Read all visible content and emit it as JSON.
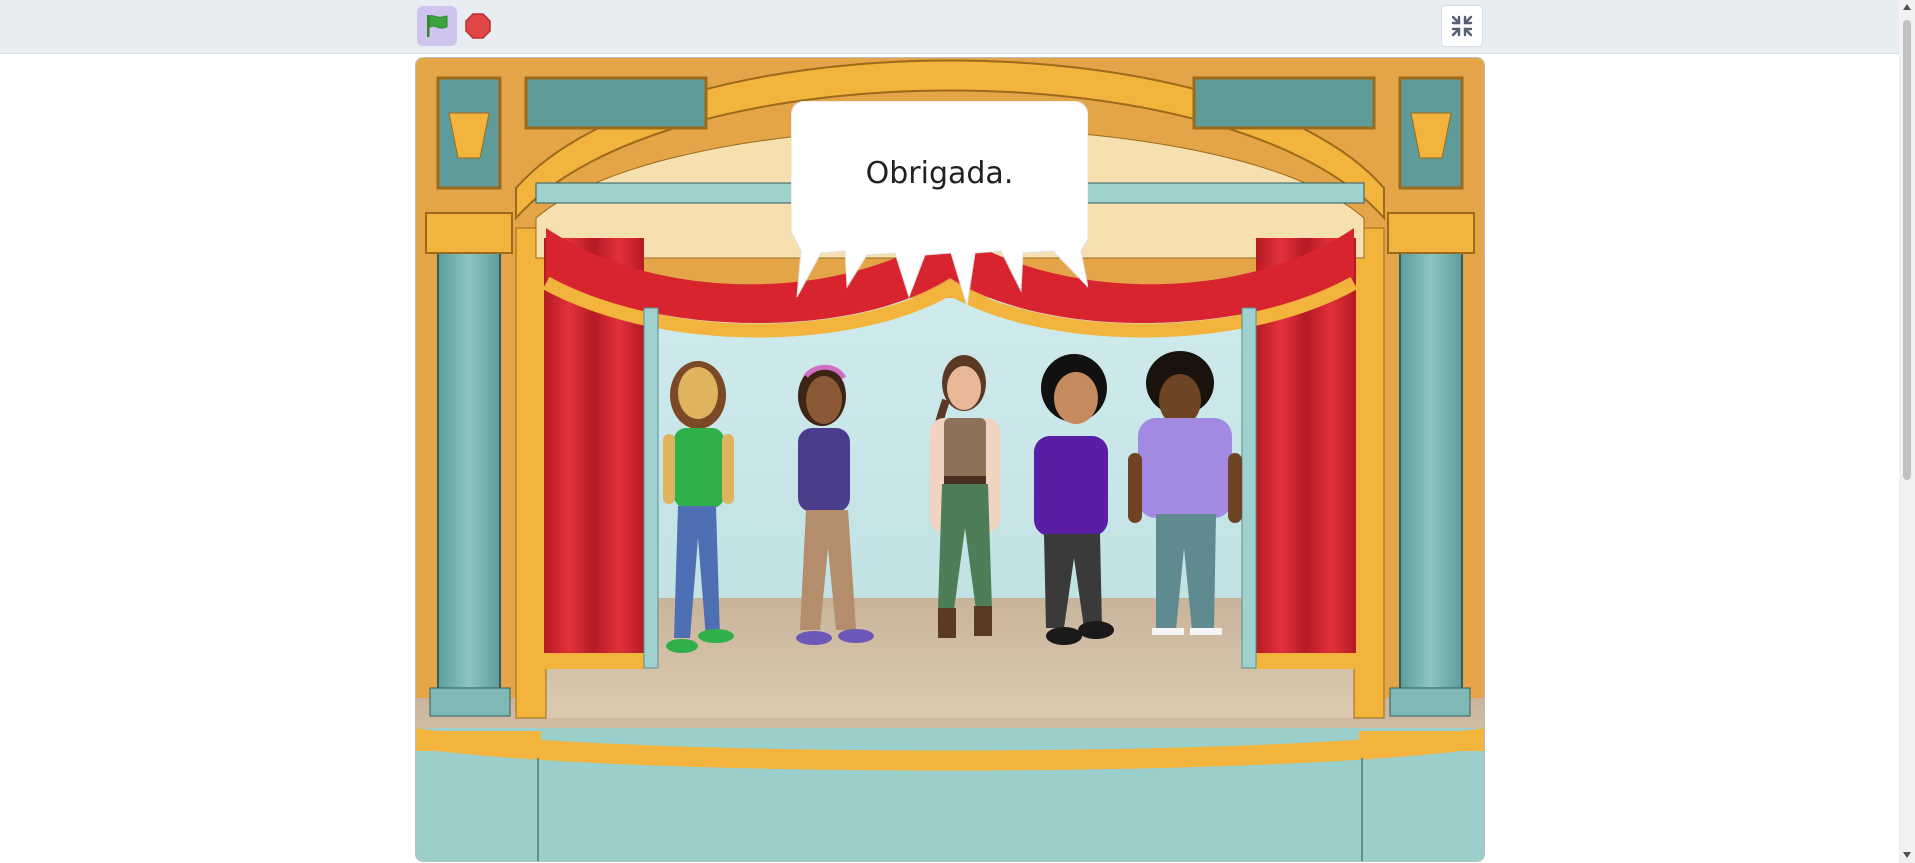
{
  "controls": {
    "green_flag": "green-flag",
    "stop": "stop-sign",
    "fullscreen": "exit-fullscreen"
  },
  "stage": {
    "speech_bubble": "Obrigada."
  },
  "colors": {
    "topbar": "#e8edf2",
    "flag_bg": "#cfc4ee",
    "flag": "#3aa53a",
    "stop": "#e04646",
    "curtain": "#d8242e",
    "gold": "#f2b43c",
    "teal": "#7fb8b4",
    "floor": "#d8c6a6"
  },
  "characters": [
    {
      "name": "girl-green-shirt"
    },
    {
      "name": "girl-purple-hoodie"
    },
    {
      "name": "woman-braid-vest"
    },
    {
      "name": "kid-purple-shirt"
    },
    {
      "name": "girl-lavender-shirt"
    }
  ]
}
